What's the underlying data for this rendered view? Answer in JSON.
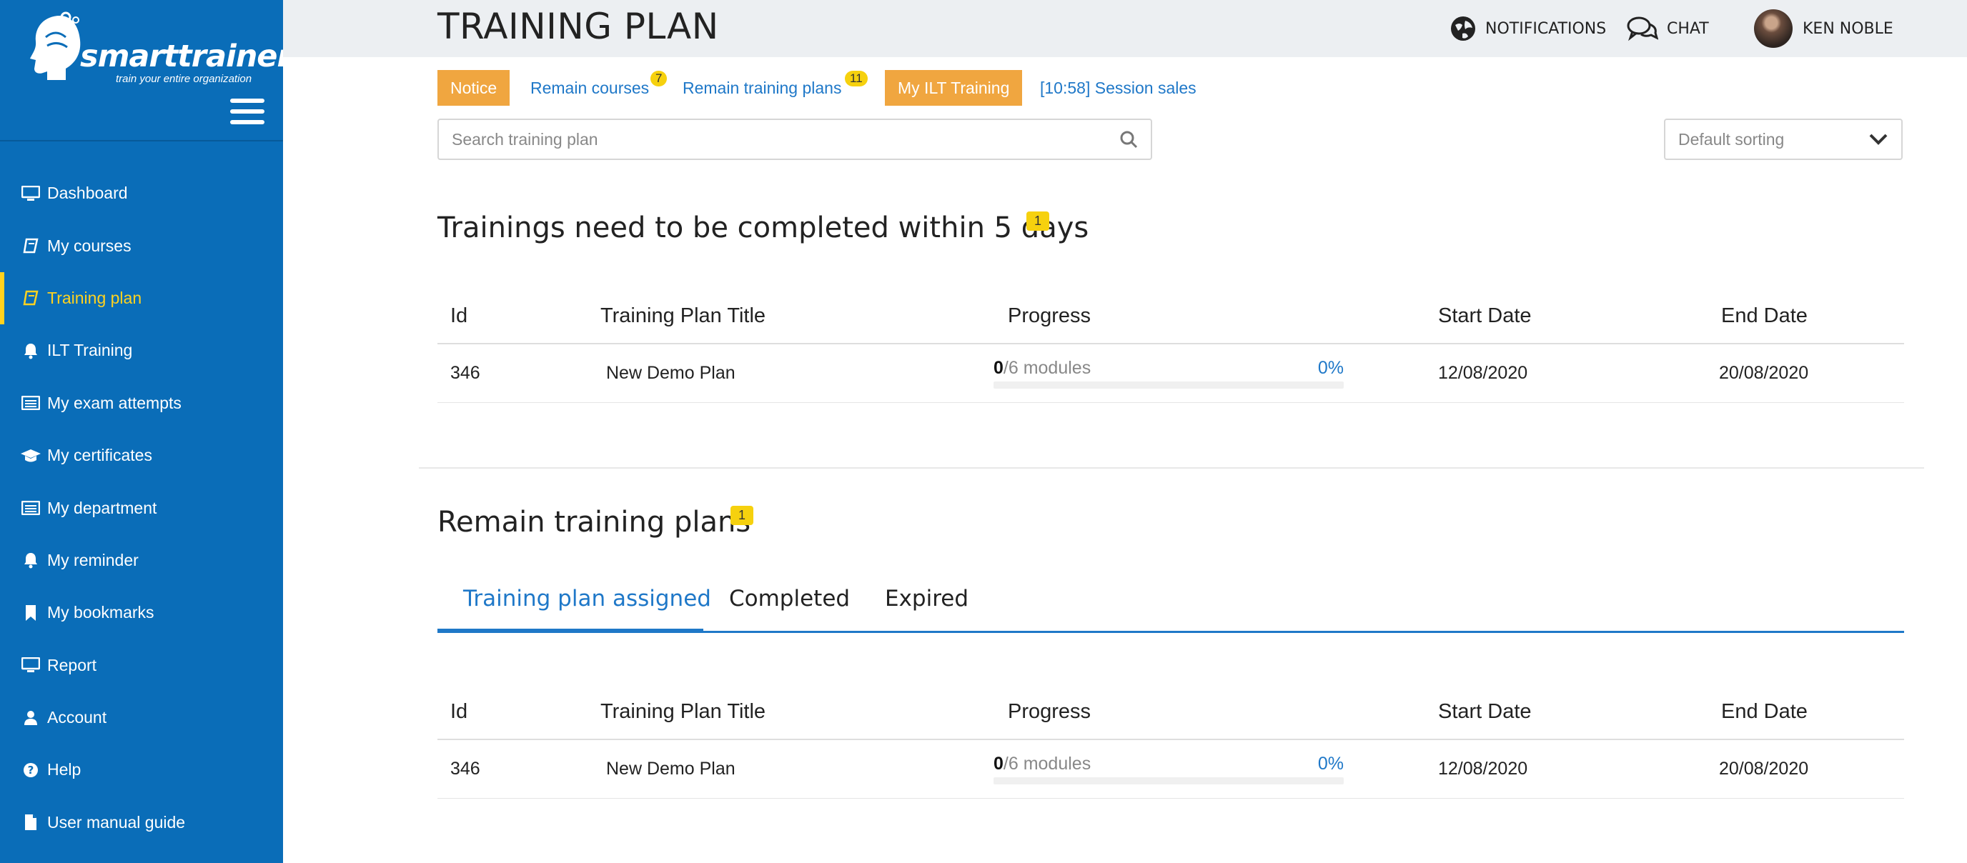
{
  "brand": {
    "name": "smarttrainer",
    "tagline": "train your entire organization"
  },
  "sidebar": {
    "items": [
      {
        "label": "Dashboard",
        "icon": "monitor-icon",
        "active": false
      },
      {
        "label": "My courses",
        "icon": "book-icon",
        "active": false
      },
      {
        "label": "Training plan",
        "icon": "book-icon",
        "active": true
      },
      {
        "label": "ILT Training",
        "icon": "bell-icon",
        "active": false
      },
      {
        "label": "My exam attempts",
        "icon": "list-icon",
        "active": false
      },
      {
        "label": "My certificates",
        "icon": "graduation-cap-icon",
        "active": false
      },
      {
        "label": "My department",
        "icon": "list-icon",
        "active": false
      },
      {
        "label": "My reminder",
        "icon": "bell-icon",
        "active": false
      },
      {
        "label": "My bookmarks",
        "icon": "bookmark-icon",
        "active": false
      },
      {
        "label": "Report",
        "icon": "monitor-icon",
        "active": false
      },
      {
        "label": "Account",
        "icon": "user-icon",
        "active": false
      },
      {
        "label": "Help",
        "icon": "question-icon",
        "active": false
      },
      {
        "label": "User manual guide",
        "icon": "file-icon",
        "active": false
      }
    ]
  },
  "header": {
    "title": "TRAINING PLAN",
    "notifications_label": "NOTIFICATIONS",
    "chat_label": "CHAT",
    "user_name": "KEN NOBLE"
  },
  "quick_links": {
    "notice": "Notice",
    "remain_courses": "Remain courses",
    "remain_courses_count": "7",
    "remain_plans": "Remain training plans",
    "remain_plans_count": "11",
    "my_ilt": "My ILT Training",
    "session_sales": "[10:58] Session sales"
  },
  "search": {
    "placeholder": "Search training plan"
  },
  "sort": {
    "selected": "Default sorting"
  },
  "urgent": {
    "heading": "Trainings need to be completed within 5 days",
    "count": "1",
    "columns": {
      "id": "Id",
      "title": "Training Plan Title",
      "progress": "Progress",
      "start": "Start Date",
      "end": "End Date"
    },
    "rows": [
      {
        "id": "346",
        "title": "New Demo Plan",
        "done": "0",
        "modules": "/6 modules",
        "percent": "0%",
        "progress_fraction": 0,
        "start": "12/08/2020",
        "end": "20/08/2020"
      }
    ]
  },
  "remain": {
    "heading": "Remain training plans",
    "count": "1",
    "tabs": [
      "Training plan assigned",
      "Completed",
      "Expired"
    ],
    "active_tab": 0,
    "columns": {
      "id": "Id",
      "title": "Training Plan Title",
      "progress": "Progress",
      "start": "Start Date",
      "end": "End Date"
    },
    "rows": [
      {
        "id": "346",
        "title": "New Demo Plan",
        "done": "0",
        "modules": "/6 modules",
        "percent": "0%",
        "progress_fraction": 0,
        "start": "12/08/2020",
        "end": "20/08/2020"
      }
    ]
  },
  "colors": {
    "sidebar": "#0a6db8",
    "active": "#ffd21f",
    "accent": "#1f78c8",
    "orange": "#f0a640",
    "badge": "#f6d10e"
  }
}
